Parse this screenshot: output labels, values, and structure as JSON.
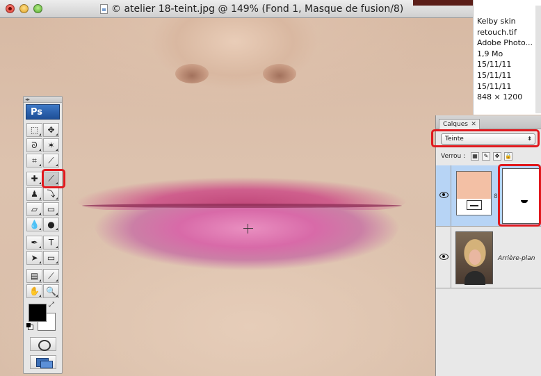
{
  "window": {
    "title": "© atelier 18-teint.jpg @ 149% (Fond 1, Masque de fusion/8)"
  },
  "file_info": {
    "lines": [
      "Kelby skin",
      "retouch.tif",
      "Adobe Photo...",
      "1,9 Mo",
      "15/11/11",
      "15/11/11",
      "15/11/11",
      "848 × 1200"
    ]
  },
  "tools": {
    "logo": "Ps",
    "items": [
      {
        "name": "rectangular-marquee-tool",
        "glyph": "⬚"
      },
      {
        "name": "move-tool",
        "glyph": "✥"
      },
      {
        "name": "lasso-tool",
        "glyph": "ᘐ"
      },
      {
        "name": "magic-wand-tool",
        "glyph": "✶"
      },
      {
        "name": "crop-tool",
        "glyph": "⌗"
      },
      {
        "name": "eyedropper-tool",
        "glyph": "⟋"
      },
      {
        "name": "healing-brush-tool",
        "glyph": "✚"
      },
      {
        "name": "brush-tool",
        "glyph": "⟋"
      },
      {
        "name": "clone-stamp-tool",
        "glyph": "♟"
      },
      {
        "name": "history-brush-tool",
        "glyph": "⤵"
      },
      {
        "name": "eraser-tool",
        "glyph": "▱"
      },
      {
        "name": "gradient-tool",
        "glyph": "▭"
      },
      {
        "name": "blur-tool",
        "glyph": "💧"
      },
      {
        "name": "dodge-tool",
        "glyph": "●"
      },
      {
        "name": "pen-tool",
        "glyph": "✒"
      },
      {
        "name": "type-tool",
        "glyph": "T"
      },
      {
        "name": "path-selection-tool",
        "glyph": "➤"
      },
      {
        "name": "rectangle-tool",
        "glyph": "▭"
      },
      {
        "name": "notes-tool",
        "glyph": "▤"
      },
      {
        "name": "eyedropper-sample-tool",
        "glyph": "⟋"
      },
      {
        "name": "hand-tool",
        "glyph": "✋"
      },
      {
        "name": "zoom-tool",
        "glyph": "🔍"
      }
    ],
    "selected": "brush-tool",
    "foreground_color": "#000000",
    "background_color": "#ffffff"
  },
  "layers": {
    "tab_label": "Calques",
    "tab_close": "✕",
    "blend_mode": "Teinte",
    "lock_label": "Verrou :",
    "lock_icons": [
      "▦",
      "✎",
      "✥",
      "🔒"
    ],
    "items": [
      {
        "name": "",
        "visible": true,
        "type": "adjustment-with-mask",
        "selected": true
      },
      {
        "name": "Arrière-plan",
        "visible": true,
        "type": "photo",
        "selected": false
      }
    ]
  },
  "colors": {
    "highlight": "#e0191e",
    "selected_layer": "#b7d4f5",
    "adjustment_swatch": "#f3c0a5"
  }
}
